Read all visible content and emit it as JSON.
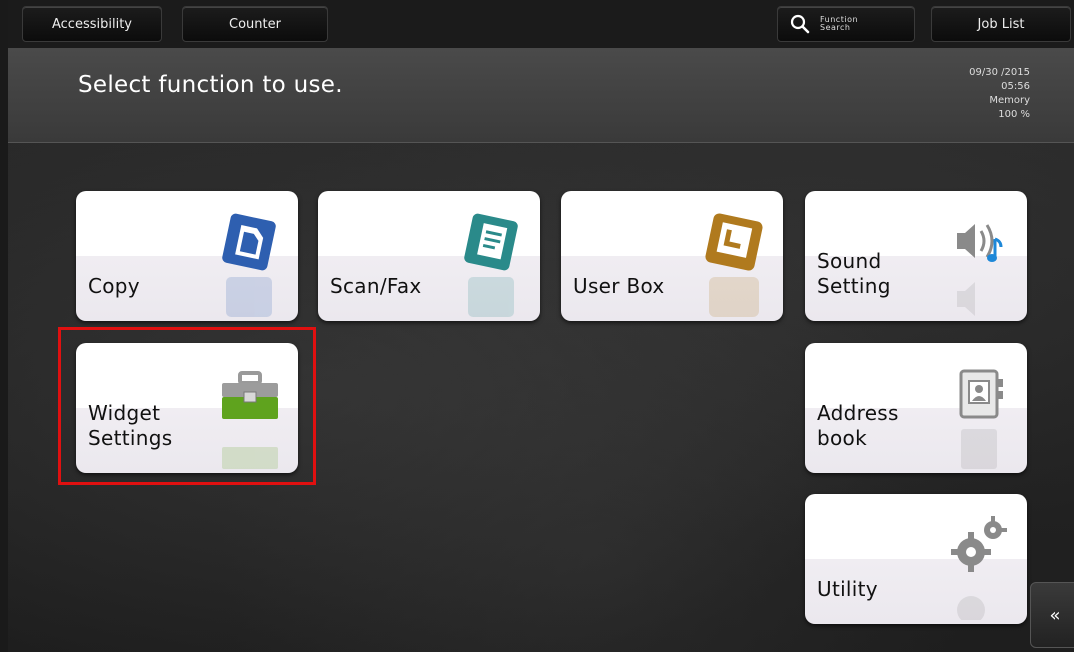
{
  "topbar": {
    "accessibility_label": "Accessibility",
    "counter_label": "Counter",
    "function_search_line1": "Function",
    "function_search_line2": "Search",
    "job_list_label": "Job List"
  },
  "header": {
    "title": "Select function to use.",
    "date": "09/30 /2015",
    "time": "05:56",
    "memory_label": "Memory",
    "memory_value": "100 %"
  },
  "tiles": {
    "copy": {
      "line1": "Copy",
      "icon": "copy-icon"
    },
    "scanfax": {
      "line1": "Scan/Fax",
      "icon": "scan-fax-icon"
    },
    "userbox": {
      "line1": "User Box",
      "icon": "user-box-icon"
    },
    "sound": {
      "line1": "Sound",
      "line2": "Setting",
      "icon": "speaker-icon"
    },
    "widget": {
      "line1": "Widget",
      "line2": "Settings",
      "icon": "toolbox-icon"
    },
    "address": {
      "line1": "Address",
      "line2": "book",
      "icon": "address-book-icon"
    },
    "utility": {
      "line1": "Utility",
      "icon": "gears-icon"
    }
  },
  "side_tab": {
    "glyph": "«",
    "icon": "double-chevron-left-icon"
  },
  "colors": {
    "highlight": "#e01010",
    "copy_icon": "#2e5fb0",
    "scanfax_icon": "#2a8a8a",
    "userbox_icon": "#b07a1e",
    "widget_icon": "#5fa31e"
  }
}
